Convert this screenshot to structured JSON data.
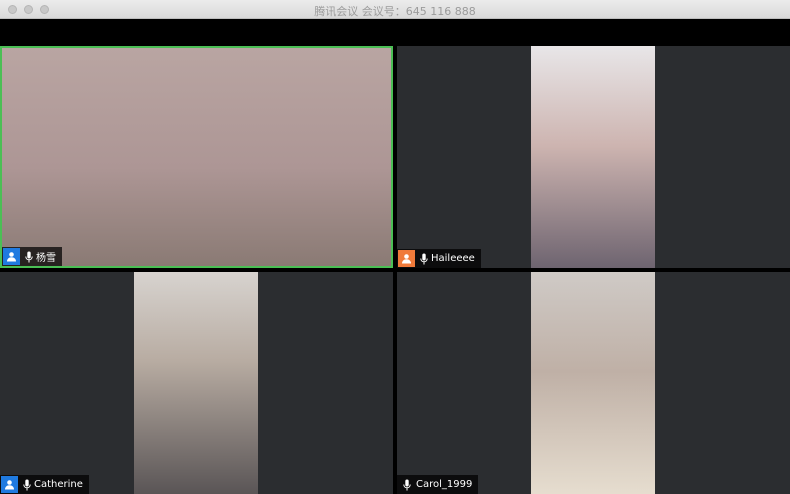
{
  "window": {
    "title": "腾讯会议 会议号：645 116 888"
  },
  "participants": [
    {
      "name": "杨雪",
      "avatar_color": "#1f7ae0",
      "active_speaker": true
    },
    {
      "name": "Haileeee",
      "avatar_color": "#f07a3a",
      "active_speaker": false
    },
    {
      "name": "Catherine",
      "avatar_color": "#1f7ae0",
      "active_speaker": false
    },
    {
      "name": "Carol_1999",
      "avatar_color": null,
      "active_speaker": false
    }
  ],
  "colors": {
    "active_border": "#4bbf55",
    "tile_bg": "#2b2d30",
    "label_bg": "#000000"
  },
  "icons": [
    "user-avatar-icon",
    "microphone-icon"
  ]
}
